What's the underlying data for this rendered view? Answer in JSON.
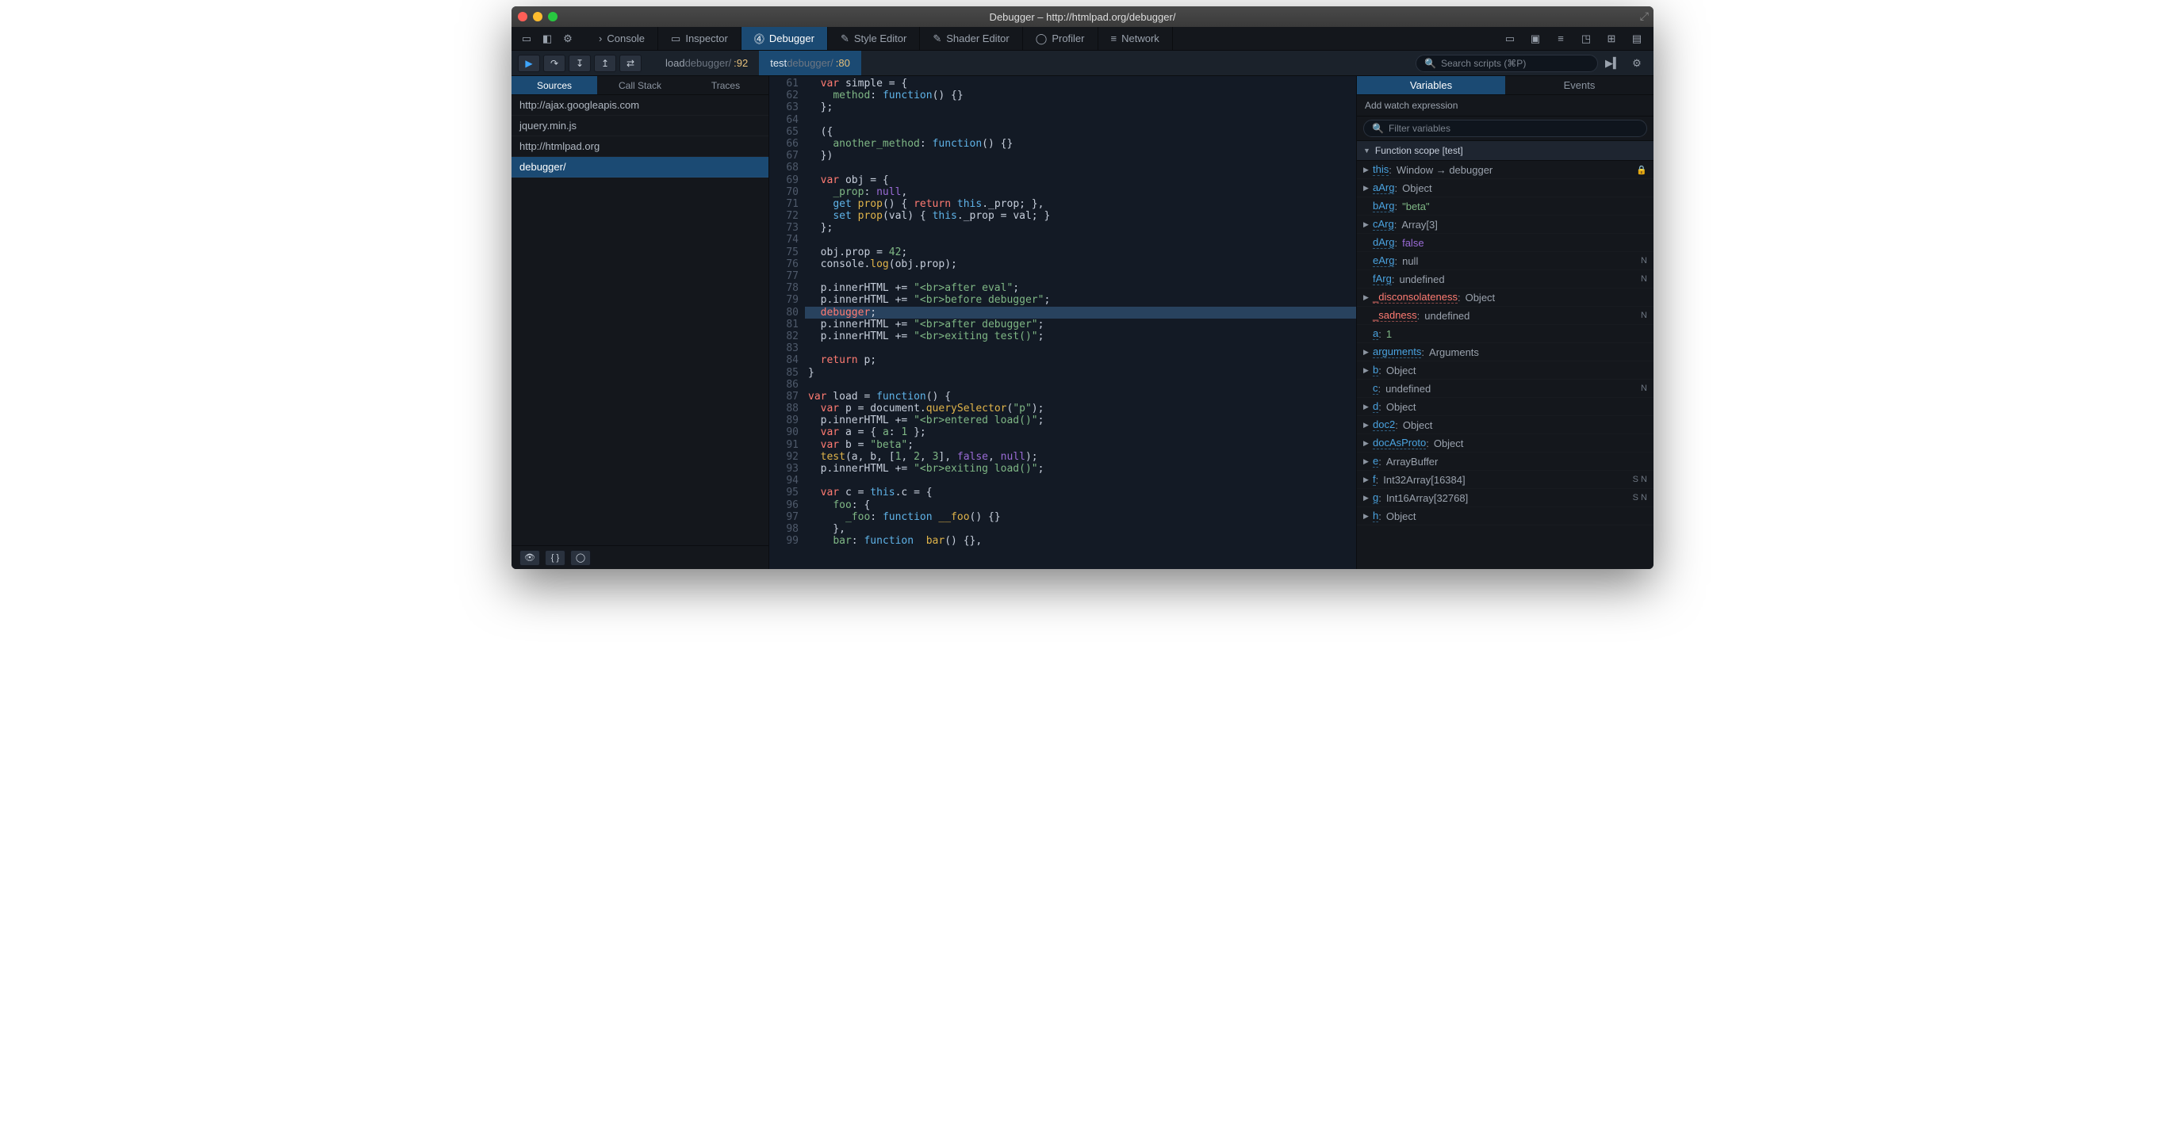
{
  "window": {
    "title": "Debugger – http://htmlpad.org/debugger/"
  },
  "tool_tabs": [
    {
      "icon": "›",
      "label": "Console"
    },
    {
      "icon": "▭",
      "label": "Inspector"
    },
    {
      "icon": "⓸",
      "label": "Debugger"
    },
    {
      "icon": "✎",
      "label": "Style Editor"
    },
    {
      "icon": "✎",
      "label": "Shader Editor"
    },
    {
      "icon": "◯",
      "label": "Profiler"
    },
    {
      "icon": "≡",
      "label": "Network"
    }
  ],
  "active_tool_tab": 2,
  "breadcrumbs": [
    {
      "prefix": "load",
      "label": "debugger/",
      "line": ":92"
    },
    {
      "prefix": "test",
      "label": "debugger/",
      "line": ":80"
    }
  ],
  "active_breadcrumb": 1,
  "search_placeholder": "Search scripts (⌘P)",
  "sidebar": {
    "tabs": [
      "Sources",
      "Call Stack",
      "Traces"
    ],
    "active_tab": 0,
    "sources": [
      "http://ajax.googleapis.com",
      "jquery.min.js",
      "http://htmlpad.org",
      "debugger/"
    ],
    "active_source": 3
  },
  "editor": {
    "first_line": 61,
    "current_line": 80,
    "lines": [
      [
        [
          "",
          "  "
        ],
        [
          "kw",
          "var"
        ],
        [
          "",
          " "
        ],
        [
          "id",
          "simple"
        ],
        [
          "",
          " = {"
        ]
      ],
      [
        [
          "",
          "    "
        ],
        [
          "prop",
          "method"
        ],
        [
          "",
          ": "
        ],
        [
          "kw2",
          "function"
        ],
        [
          "",
          "() {}"
        ]
      ],
      [
        [
          "",
          "  };"
        ]
      ],
      [
        [
          "",
          ""
        ]
      ],
      [
        [
          "",
          "  ({"
        ]
      ],
      [
        [
          "",
          "    "
        ],
        [
          "prop",
          "another_method"
        ],
        [
          "",
          ": "
        ],
        [
          "kw2",
          "function"
        ],
        [
          "",
          "() {}"
        ]
      ],
      [
        [
          "",
          "  })"
        ]
      ],
      [
        [
          "",
          ""
        ]
      ],
      [
        [
          "",
          "  "
        ],
        [
          "kw",
          "var"
        ],
        [
          "",
          " obj = {"
        ]
      ],
      [
        [
          "",
          "    "
        ],
        [
          "prop",
          "_prop"
        ],
        [
          "",
          ": "
        ],
        [
          "null",
          "null"
        ],
        [
          "",
          ","
        ]
      ],
      [
        [
          "",
          "    "
        ],
        [
          "kw2",
          "get"
        ],
        [
          "",
          " "
        ],
        [
          "fn",
          "prop"
        ],
        [
          "",
          "() { "
        ],
        [
          "kw",
          "return"
        ],
        [
          "",
          " "
        ],
        [
          "kw2",
          "this"
        ],
        [
          "",
          "._prop; },"
        ]
      ],
      [
        [
          "",
          "    "
        ],
        [
          "kw2",
          "set"
        ],
        [
          "",
          " "
        ],
        [
          "fn",
          "prop"
        ],
        [
          "",
          "(val) { "
        ],
        [
          "kw2",
          "this"
        ],
        [
          "",
          "._prop = val; }"
        ]
      ],
      [
        [
          "",
          "  };"
        ]
      ],
      [
        [
          "",
          ""
        ]
      ],
      [
        [
          "",
          "  obj.prop = "
        ],
        [
          "num",
          "42"
        ],
        [
          "",
          ";"
        ]
      ],
      [
        [
          "",
          "  console."
        ],
        [
          "fn",
          "log"
        ],
        [
          "",
          "(obj.prop);"
        ]
      ],
      [
        [
          "",
          ""
        ]
      ],
      [
        [
          "",
          "  p.innerHTML += "
        ],
        [
          "str",
          "\"<br>after eval\""
        ],
        [
          "",
          ";"
        ]
      ],
      [
        [
          "",
          "  p.innerHTML += "
        ],
        [
          "str",
          "\"<br>before debugger\""
        ],
        [
          "",
          ";"
        ]
      ],
      [
        [
          "",
          "  "
        ],
        [
          "kw",
          "debugger"
        ],
        [
          "",
          ";"
        ]
      ],
      [
        [
          "",
          "  p.innerHTML += "
        ],
        [
          "str",
          "\"<br>after debugger\""
        ],
        [
          "",
          ";"
        ]
      ],
      [
        [
          "",
          "  p.innerHTML += "
        ],
        [
          "str",
          "\"<br>exiting test()\""
        ],
        [
          "",
          ";"
        ]
      ],
      [
        [
          "",
          ""
        ]
      ],
      [
        [
          "",
          "  "
        ],
        [
          "kw",
          "return"
        ],
        [
          "",
          " p;"
        ]
      ],
      [
        [
          "",
          "}"
        ]
      ],
      [
        [
          "",
          ""
        ]
      ],
      [
        [
          "kw",
          "var"
        ],
        [
          "",
          " load = "
        ],
        [
          "kw2",
          "function"
        ],
        [
          "",
          "() {"
        ]
      ],
      [
        [
          "",
          "  "
        ],
        [
          "kw",
          "var"
        ],
        [
          "",
          " p = "
        ],
        [
          "id",
          "document"
        ],
        [
          "",
          "."
        ],
        [
          "fn",
          "querySelector"
        ],
        [
          "",
          "("
        ],
        [
          "str",
          "\"p\""
        ],
        [
          "",
          ");"
        ]
      ],
      [
        [
          "",
          "  p.innerHTML += "
        ],
        [
          "str",
          "\"<br>entered load()\""
        ],
        [
          "",
          ";"
        ]
      ],
      [
        [
          "",
          "  "
        ],
        [
          "kw",
          "var"
        ],
        [
          "",
          " a = { "
        ],
        [
          "prop",
          "a"
        ],
        [
          "",
          ": "
        ],
        [
          "num",
          "1"
        ],
        [
          "",
          " };"
        ]
      ],
      [
        [
          "",
          "  "
        ],
        [
          "kw",
          "var"
        ],
        [
          "",
          " b = "
        ],
        [
          "str",
          "\"beta\""
        ],
        [
          "",
          ";"
        ]
      ],
      [
        [
          "",
          "  "
        ],
        [
          "fn",
          "test"
        ],
        [
          "",
          "(a, b, ["
        ],
        [
          "num",
          "1"
        ],
        [
          "",
          ", "
        ],
        [
          "num",
          "2"
        ],
        [
          "",
          ", "
        ],
        [
          "num",
          "3"
        ],
        [
          "",
          "], "
        ],
        [
          "bool",
          "false"
        ],
        [
          "",
          ", "
        ],
        [
          "null",
          "null"
        ],
        [
          "",
          ");"
        ]
      ],
      [
        [
          "",
          "  p.innerHTML += "
        ],
        [
          "str",
          "\"<br>exiting load()\""
        ],
        [
          "",
          ";"
        ]
      ],
      [
        [
          "",
          ""
        ]
      ],
      [
        [
          "",
          "  "
        ],
        [
          "kw",
          "var"
        ],
        [
          "",
          " c = "
        ],
        [
          "kw2",
          "this"
        ],
        [
          "",
          ".c = {"
        ]
      ],
      [
        [
          "",
          "    "
        ],
        [
          "prop",
          "foo"
        ],
        [
          "",
          ": {"
        ]
      ],
      [
        [
          "",
          "      "
        ],
        [
          "prop",
          "_foo"
        ],
        [
          "",
          ": "
        ],
        [
          "kw2",
          "function"
        ],
        [
          "",
          " "
        ],
        [
          "fn",
          "__foo"
        ],
        [
          "",
          "() {}"
        ]
      ],
      [
        [
          "",
          "    },"
        ]
      ],
      [
        [
          "",
          "    "
        ],
        [
          "prop",
          "bar"
        ],
        [
          "",
          ": "
        ],
        [
          "kw2",
          "function"
        ],
        [
          "",
          "  "
        ],
        [
          "fn",
          "bar"
        ],
        [
          "",
          "() {},"
        ]
      ]
    ]
  },
  "variables": {
    "tabs": [
      "Variables",
      "Events"
    ],
    "active_tab": 0,
    "watch_label": "Add watch expression",
    "filter_placeholder": "Filter variables",
    "scope_label": "Function scope [test]",
    "rows": [
      {
        "tri": "▶",
        "name": "this",
        "cls": "",
        "val": "Window → debugger",
        "vt": "",
        "badge": "lock"
      },
      {
        "tri": "▶",
        "name": "aArg",
        "cls": "",
        "val": "Object",
        "vt": ""
      },
      {
        "tri": "",
        "name": "bArg",
        "cls": "",
        "val": "\"beta\"",
        "vt": "str"
      },
      {
        "tri": "▶",
        "name": "cArg",
        "cls": "",
        "val": "Array[3]",
        "vt": ""
      },
      {
        "tri": "",
        "name": "dArg",
        "cls": "",
        "val": "false",
        "vt": "bool"
      },
      {
        "tri": "",
        "name": "eArg",
        "cls": "",
        "val": "null",
        "vt": "",
        "badge": "N"
      },
      {
        "tri": "",
        "name": "fArg",
        "cls": "",
        "val": "undefined",
        "vt": "",
        "badge": "N"
      },
      {
        "tri": "▶",
        "name": "_disconsolateness",
        "cls": "red",
        "val": "Object",
        "vt": ""
      },
      {
        "tri": "",
        "name": "_sadness",
        "cls": "red",
        "val": "undefined",
        "vt": "",
        "badge": "N"
      },
      {
        "tri": "",
        "name": "a",
        "cls": "",
        "val": "1",
        "vt": "num"
      },
      {
        "tri": "▶",
        "name": "arguments",
        "cls": "",
        "val": "Arguments",
        "vt": ""
      },
      {
        "tri": "▶",
        "name": "b",
        "cls": "",
        "val": "Object",
        "vt": ""
      },
      {
        "tri": "",
        "name": "c",
        "cls": "",
        "val": "undefined",
        "vt": "",
        "badge": "N"
      },
      {
        "tri": "▶",
        "name": "d",
        "cls": "",
        "val": "Object",
        "vt": ""
      },
      {
        "tri": "▶",
        "name": "doc2",
        "cls": "",
        "val": "Object",
        "vt": ""
      },
      {
        "tri": "▶",
        "name": "docAsProto",
        "cls": "",
        "val": "Object",
        "vt": ""
      },
      {
        "tri": "▶",
        "name": "e",
        "cls": "",
        "val": "ArrayBuffer",
        "vt": ""
      },
      {
        "tri": "▶",
        "name": "f",
        "cls": "",
        "val": "Int32Array[16384]",
        "vt": "",
        "badge": "S N"
      },
      {
        "tri": "▶",
        "name": "g",
        "cls": "",
        "val": "Int16Array[32768]",
        "vt": "",
        "badge": "S N"
      },
      {
        "tri": "▶",
        "name": "h",
        "cls": "",
        "val": "Object",
        "vt": ""
      }
    ]
  }
}
